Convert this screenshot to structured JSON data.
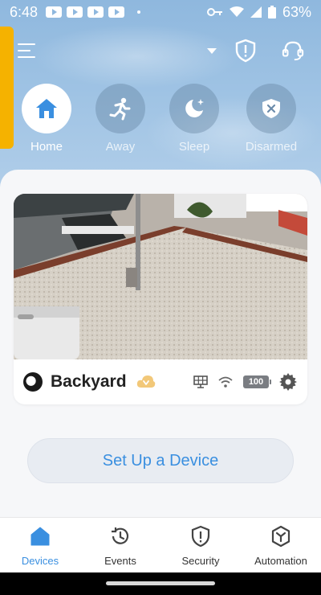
{
  "status_bar": {
    "time": "6:48",
    "battery_percent": "63%"
  },
  "modes": [
    {
      "label": "Home",
      "icon": "home-icon",
      "active": true
    },
    {
      "label": "Away",
      "icon": "running-person-icon",
      "active": false
    },
    {
      "label": "Sleep",
      "icon": "moon-icon",
      "active": false
    },
    {
      "label": "Disarmed",
      "icon": "disarmed-shield-icon",
      "active": false
    }
  ],
  "camera": {
    "name": "Backyard",
    "battery_level": "100"
  },
  "setup_button": {
    "label": "Set Up a Device"
  },
  "nav": [
    {
      "label": "Devices",
      "icon": "devices-icon",
      "active": true
    },
    {
      "label": "Events",
      "icon": "history-icon",
      "active": false
    },
    {
      "label": "Security",
      "icon": "security-shield-icon",
      "active": false
    },
    {
      "label": "Automation",
      "icon": "automation-icon",
      "active": false
    }
  ],
  "colors": {
    "accent": "#3a8fe0",
    "side_tab": "#f5b200",
    "sky": "#9fc3e4"
  }
}
